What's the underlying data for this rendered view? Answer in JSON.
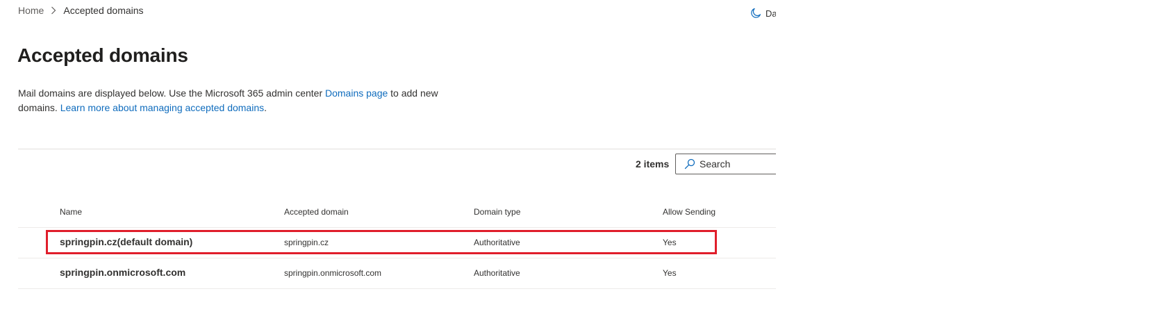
{
  "breadcrumb": {
    "home": "Home",
    "current": "Accepted domains"
  },
  "header": {
    "dark_mode_label": "Dark mode"
  },
  "page": {
    "title": "Accepted domains",
    "description": {
      "part1": "Mail domains are displayed below. Use the Microsoft 365 admin center ",
      "link1": "Domains page",
      "part2": " to add new domains. ",
      "link2": "Learn more about managing accepted domains",
      "part3": "."
    }
  },
  "toolbar": {
    "items_count": "2 items",
    "search_placeholder": "Search"
  },
  "table": {
    "columns": [
      "Name",
      "Accepted domain",
      "Domain type",
      "Allow Sending"
    ],
    "rows": [
      {
        "name": "springpin.cz(default domain)",
        "accepted_domain": "springpin.cz",
        "domain_type": "Authoritative",
        "allow_sending": "Yes",
        "highlighted": true
      },
      {
        "name": "springpin.onmicrosoft.com",
        "accepted_domain": "springpin.onmicrosoft.com",
        "domain_type": "Authoritative",
        "allow_sending": "Yes",
        "highlighted": false
      }
    ]
  },
  "colors": {
    "link": "#0f6cbd",
    "highlight": "#e01e2b",
    "text": "#323130"
  },
  "icons": {
    "breadcrumb_separator": "chevron-right-icon",
    "dark_mode": "moon-icon",
    "search": "search-icon"
  }
}
